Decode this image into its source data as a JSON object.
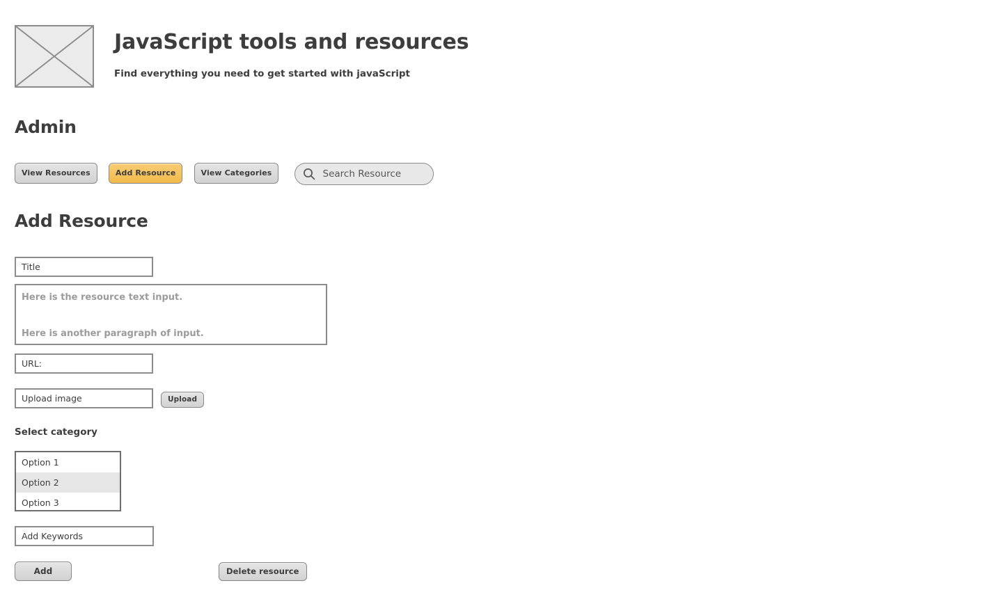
{
  "header": {
    "logo_icon": "image-placeholder-icon",
    "title": "JavaScript tools and resources",
    "subtitle": "Find everything you need to get started with javaScript"
  },
  "admin": {
    "heading": "Admin",
    "toolbar": {
      "view_resources_label": "View Resources",
      "add_resource_label": "Add Resource",
      "view_categories_label": "View Categories",
      "active_button": "Add Resource",
      "accent_color": "#f3ba4b"
    },
    "search": {
      "icon": "search-icon",
      "placeholder": "Search Resource",
      "value": ""
    }
  },
  "form": {
    "heading": "Add Resource",
    "title_field": {
      "placeholder": "Title",
      "value": ""
    },
    "description_field": {
      "line1": "Here is the resource text input.",
      "line2": "Here is another paragraph of input."
    },
    "url_field": {
      "placeholder": "URL:",
      "value": ""
    },
    "upload_field": {
      "placeholder": "Upload image",
      "value": ""
    },
    "upload_button_label": "Upload",
    "select_category": {
      "label": "Select category",
      "options": [
        {
          "label": "Option 1",
          "selected": false
        },
        {
          "label": "Option 2",
          "selected": true
        },
        {
          "label": "Option 3",
          "selected": false
        }
      ]
    },
    "keywords_field": {
      "placeholder": "Add Keywords",
      "value": ""
    },
    "add_button_label": "Add",
    "delete_button_label": "Delete resource"
  }
}
